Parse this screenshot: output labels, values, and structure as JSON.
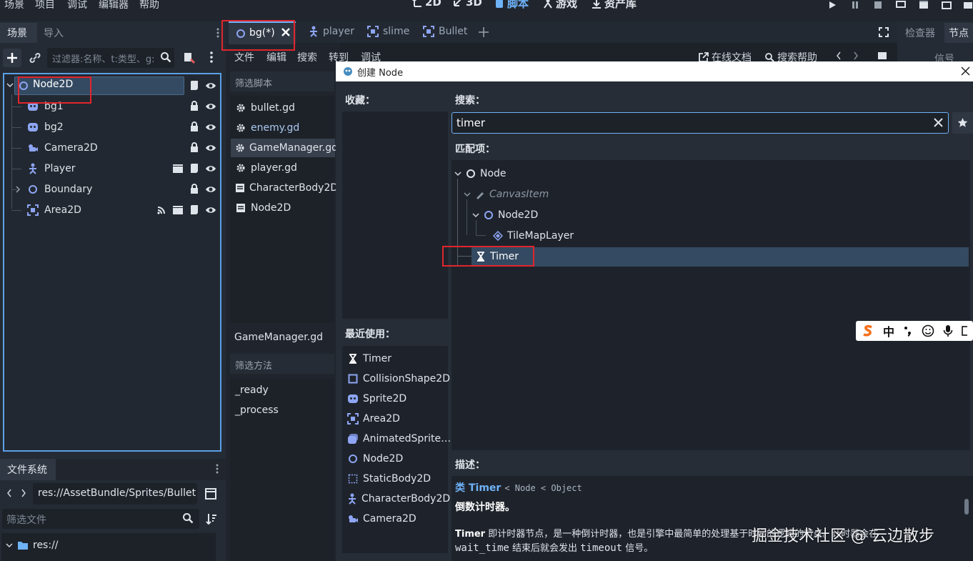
{
  "menubar": {
    "items": [
      "场景",
      "项目",
      "调试",
      "编辑器",
      "帮助"
    ],
    "workspaces": [
      {
        "label": "2D",
        "icon": "2d-icon"
      },
      {
        "label": "3D",
        "icon": "3d-icon"
      },
      {
        "label": "脚本",
        "icon": "script-icon",
        "active": true
      },
      {
        "label": "游戏",
        "icon": "game-icon"
      },
      {
        "label": "资产库",
        "icon": "assetlib-icon"
      }
    ]
  },
  "scene_dock": {
    "tabs": [
      "场景",
      "导入"
    ],
    "filter_placeholder": "过滤器:名称、t:类型、g:",
    "nodes": [
      {
        "label": "Node2D",
        "icon": "node2d-icon",
        "selected": true
      },
      {
        "label": "bg1",
        "icon": "sprite2d-icon"
      },
      {
        "label": "bg2",
        "icon": "sprite2d-icon"
      },
      {
        "label": "Camera2D",
        "icon": "camera2d-icon"
      },
      {
        "label": "Player",
        "icon": "characterbody2d-icon"
      },
      {
        "label": "Boundary",
        "icon": "node2d-icon"
      },
      {
        "label": "Area2D",
        "icon": "area2d-icon"
      }
    ]
  },
  "filesystem": {
    "title": "文件系统",
    "path": "res://AssetBundle/Sprites/Bullet.",
    "filter_placeholder": "筛选文件",
    "root": "res://"
  },
  "editor_tabs": [
    {
      "label": "bg(*)",
      "icon": "node2d-icon",
      "active": true
    },
    {
      "label": "player",
      "icon": "characterbody2d-icon"
    },
    {
      "label": "slime",
      "icon": "area2d-icon"
    },
    {
      "label": "Bullet",
      "icon": "area2d-icon"
    }
  ],
  "script_menu": [
    "文件",
    "编辑",
    "搜索",
    "转到",
    "调试"
  ],
  "script_toolbar": {
    "online_docs": "在线文档",
    "search_help": "搜索帮助"
  },
  "right_tabs": [
    "检查器",
    "节点"
  ],
  "right_signal": "信号",
  "script_panel": {
    "filter_scripts": "筛选脚本",
    "scripts": [
      {
        "label": "bullet.gd",
        "icon": "gear-icon"
      },
      {
        "label": "enemy.gd",
        "icon": "gear-icon",
        "highlight": true
      },
      {
        "label": "GameManager.gd",
        "icon": "gear-icon",
        "selected": true
      },
      {
        "label": "player.gd",
        "icon": "gear-icon"
      },
      {
        "label": "CharacterBody2D",
        "icon": "doc-icon"
      },
      {
        "label": "Node2D",
        "icon": "doc-icon"
      }
    ],
    "current_script": "GameManager.gd",
    "filter_methods": "筛选方法",
    "methods": [
      "_ready",
      "_process"
    ]
  },
  "create_dialog": {
    "title": "创建 Node",
    "favorites_label": "收藏：",
    "search_label": "搜索：",
    "search_value": "timer",
    "matches_label": "匹配项：",
    "matches": [
      {
        "label": "Node",
        "depth": 0,
        "icon": "node-icon"
      },
      {
        "label": "CanvasItem",
        "depth": 1,
        "icon": "canvasitem-icon",
        "dim": true
      },
      {
        "label": "Node2D",
        "depth": 2,
        "icon": "node2d-icon"
      },
      {
        "label": "TileMapLayer",
        "depth": 3,
        "icon": "tilemaplayer-icon"
      },
      {
        "label": "Timer",
        "depth": 1,
        "icon": "timer-icon",
        "selected": true
      }
    ],
    "recent_label": "最近使用：",
    "recent": [
      {
        "label": "Timer",
        "icon": "timer-icon"
      },
      {
        "label": "CollisionShape2D",
        "icon": "collisionshape2d-icon"
      },
      {
        "label": "Sprite2D",
        "icon": "sprite2d-icon"
      },
      {
        "label": "Area2D",
        "icon": "area2d-icon"
      },
      {
        "label": "AnimatedSprite…",
        "icon": "animatedsprite2d-icon"
      },
      {
        "label": "Node2D",
        "icon": "node2d-icon"
      },
      {
        "label": "StaticBody2D",
        "icon": "staticbody2d-icon"
      },
      {
        "label": "CharacterBody2D",
        "icon": "characterbody2d-icon"
      },
      {
        "label": "Camera2D",
        "icon": "camera2d-icon"
      }
    ],
    "description_label": "描述：",
    "class_prefix": "类",
    "class_name": "Timer",
    "inheritance": "< Node < Object",
    "brief": "倒数计时器。",
    "desc_line1_bold": "Timer",
    "desc_line1": " 即计时器节点，是一种倒计时器，也是引擎中最简单的处理基于时间的逻辑的节点。计时器会在",
    "desc_line2_code1": "wait_time",
    "desc_line2_mid": " 结束后就会发出 ",
    "desc_line2_code2": "timeout",
    "desc_line2_end": " 信号。"
  },
  "ime_bar": {
    "lang": "中"
  },
  "watermark": "掘金技术社区 @ 云边散步",
  "colors": {
    "accent": "#6eb2f7",
    "selection": "#344a62",
    "highlight_box": "#e1252d"
  }
}
